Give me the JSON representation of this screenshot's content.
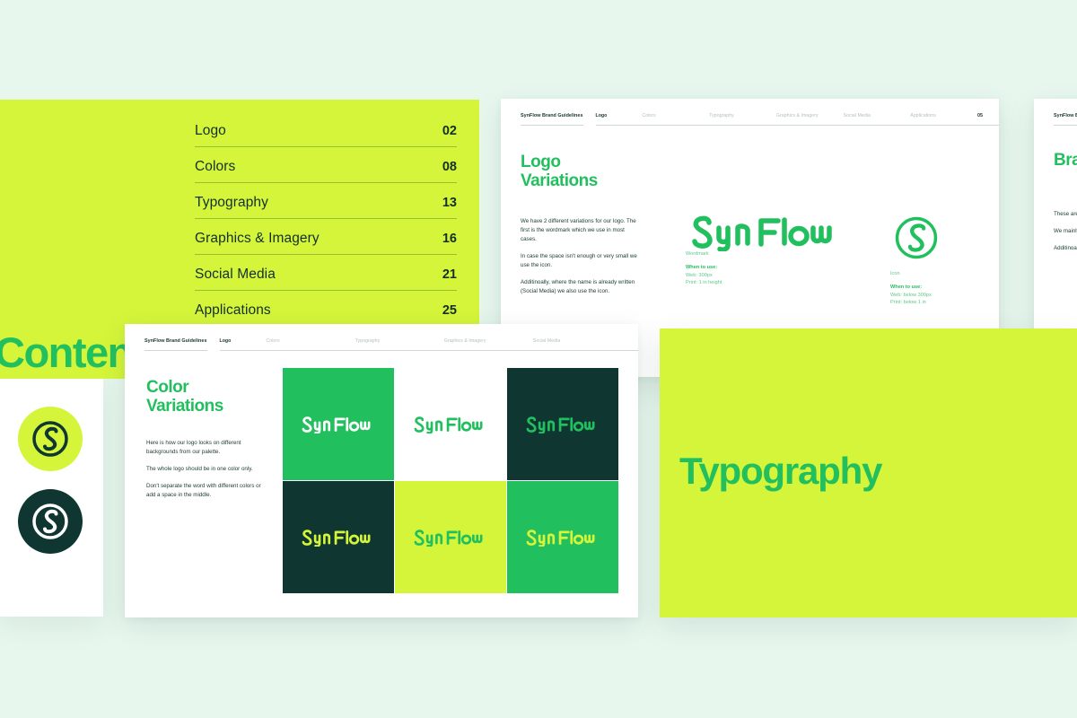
{
  "palette": {
    "background": "#e7f7ee",
    "lime": "#d4f53a",
    "green": "#22bf5f",
    "dark_teal": "#0f3631",
    "white": "#ffffff",
    "muted_nav": "#b3c0bc"
  },
  "brand_name": "SynFlow",
  "contents_panel": {
    "title": "Contents",
    "entries": [
      {
        "label": "Logo",
        "page": "02"
      },
      {
        "label": "Colors",
        "page": "08"
      },
      {
        "label": "Typography",
        "page": "13"
      },
      {
        "label": "Graphics & Imagery",
        "page": "16"
      },
      {
        "label": "Social Media",
        "page": "21"
      },
      {
        "label": "Applications",
        "page": "25"
      }
    ]
  },
  "badges": {
    "lime_badge_bg": "#d4f53a",
    "lime_badge_mark": "#0f3631",
    "dark_badge_bg": "#0f3631",
    "dark_badge_mark": "#ffffff"
  },
  "page_header": {
    "brand_line": "SynFlow Brand Guidelines",
    "nav": [
      "Logo",
      "Colors",
      "Typography",
      "Graphics & Imagery",
      "Social Media",
      "Applications"
    ],
    "active_nav": "Logo",
    "page_number": "05"
  },
  "logo_card": {
    "title": "Logo\nVariations",
    "paragraphs": [
      "We have 2 different variations for our logo. The first is the wordmark which we use in most cases.",
      "In case the space isn't enough or very small we use the icon.",
      "Additinoally, where the name is already written (Social Media) we also use the icon."
    ],
    "wordmark": {
      "label": "Wordmark",
      "when_to_use_heading": "When to use:",
      "web": "Web: 300px",
      "print": "Print: 1 in height"
    },
    "icon": {
      "label": "Icon",
      "when_to_use_heading": "When to use:",
      "web": "Web: below 300px",
      "print": "Print: below 1 in"
    }
  },
  "color_card": {
    "title": "Color\nVariations",
    "header_brand_line": "SynFlow Brand Guidelines",
    "nav": [
      "Logo",
      "Colors",
      "Typography",
      "Graphics & Imagery",
      "Social Media"
    ],
    "active_nav": "Logo",
    "paragraphs": [
      "Here is how our logo looks on different backgrounds from our palette.",
      "The whole logo should be in one color only.",
      "Don't separate the word with different colors or add a space in the middle."
    ],
    "swatches": [
      {
        "bg": "#22bf5f",
        "mark": "#ffffff"
      },
      {
        "bg": "#ffffff",
        "mark": "#22bf5f"
      },
      {
        "bg": "#0f3631",
        "mark": "#22bf5f"
      },
      {
        "bg": "#0f3631",
        "mark": "#d4f53a"
      },
      {
        "bg": "#d4f53a",
        "mark": "#22bf5f"
      },
      {
        "bg": "#22bf5f",
        "mark": "#d4f53a"
      }
    ]
  },
  "brand_card": {
    "header_brand_line": "SynFlow Bran",
    "title": "Bran",
    "paragraphs": [
      "These are",
      "We mainly our eleme special da",
      "Additinoa backgrou modern vi"
    ]
  },
  "typography_card": {
    "title": "Typography"
  }
}
